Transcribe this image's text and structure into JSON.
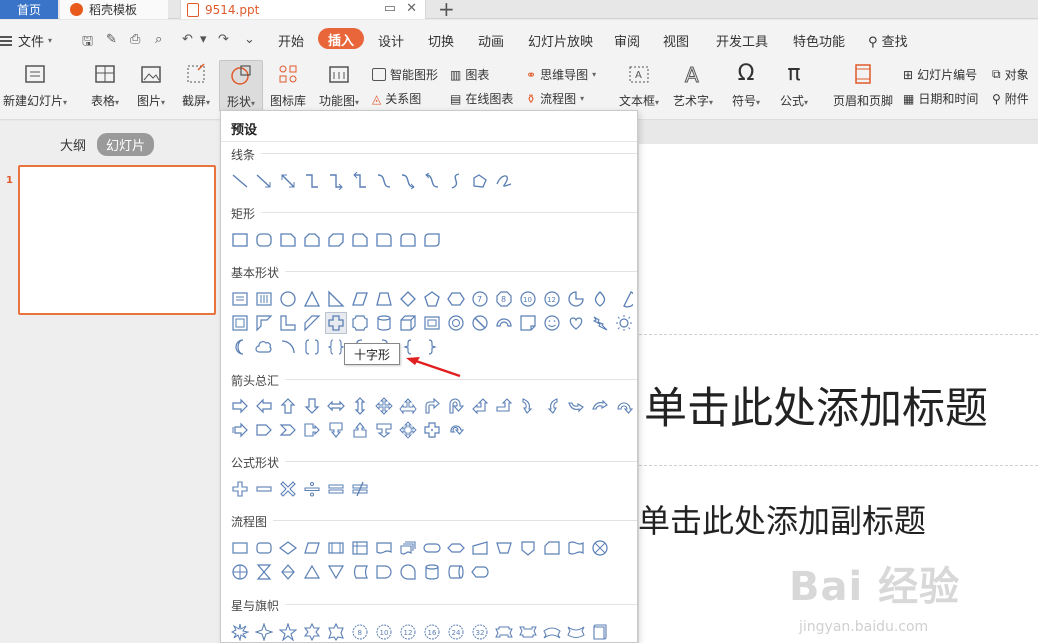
{
  "tabs": {
    "home": "首页",
    "template": "稻壳模板",
    "file": "9514.ppt"
  },
  "menu": {
    "file": "文件",
    "items": [
      "开始",
      "插入",
      "设计",
      "切换",
      "动画",
      "幻灯片放映",
      "审阅",
      "视图",
      "开发工具",
      "特色功能"
    ],
    "active": "插入",
    "search": "查找"
  },
  "ribbon": {
    "new_slide": "新建幻灯片",
    "table": "表格",
    "picture": "图片",
    "screenshot": "截屏",
    "shape": "形状",
    "icon_lib": "图标库",
    "func_chart": "功能图",
    "smart_shape": "智能图形",
    "chart": "图表",
    "relation": "关系图",
    "online_chart": "在线图表",
    "mindmap": "思维导图",
    "flowchart": "流程图",
    "textbox": "文本框",
    "wordart": "艺术字",
    "symbol": "符号",
    "formula": "公式",
    "header_footer": "页眉和页脚",
    "slide_number": "幻灯片编号",
    "datetime": "日期和时间",
    "object": "对象",
    "attachment": "附件"
  },
  "panel": {
    "outline": "大纲",
    "slides": "幻灯片",
    "slide_number": "1"
  },
  "slide": {
    "title_placeholder": "单击此处添加标题",
    "subtitle_placeholder": "单击此处添加副标题",
    "watermark": "Bai 经验",
    "watermark_url": "jingyan.baidu.com"
  },
  "dropdown": {
    "heading": "预设",
    "sections": [
      "线条",
      "矩形",
      "基本形状",
      "箭头总汇",
      "公式形状",
      "流程图",
      "星与旗帜"
    ]
  },
  "tooltip": "十字形",
  "colors": {
    "accent": "#e8663a",
    "home_tab": "#3a74c9",
    "shape_stroke": "#5a7fb5",
    "callout_arrow": "#e02020"
  }
}
